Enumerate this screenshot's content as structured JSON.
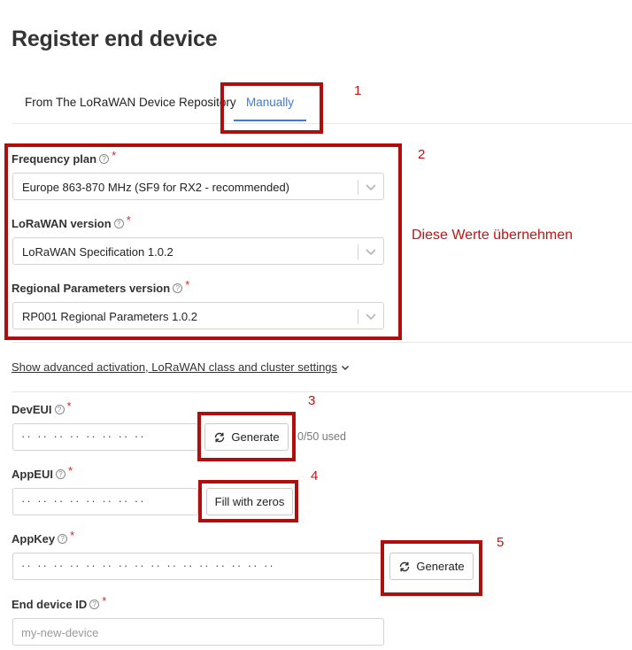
{
  "page": {
    "title": "Register end device"
  },
  "tabs": [
    {
      "label": "From The LoRaWAN Device Repository",
      "active": false
    },
    {
      "label": "Manually",
      "active": true
    }
  ],
  "fields": {
    "frequency_plan": {
      "label": "Frequency plan",
      "value": "Europe 863-870 MHz (SF9 for RX2 - recommended)"
    },
    "lorawan_version": {
      "label": "LoRaWAN version",
      "value": "LoRaWAN Specification 1.0.2"
    },
    "regional_params": {
      "label": "Regional Parameters version",
      "value": "RP001 Regional Parameters 1.0.2"
    },
    "dev_eui": {
      "label": "DevEUI",
      "value": "·· ·· ·· ·· ·· ·· ·· ··",
      "button": "Generate",
      "usage": "0/50 used"
    },
    "app_eui": {
      "label": "AppEUI",
      "value": "·· ·· ·· ·· ·· ·· ·· ··",
      "button": "Fill with zeros"
    },
    "app_key": {
      "label": "AppKey",
      "value": "·· ·· ·· ·· ·· ·· ·· ·· ·· ·· ·· ·· ·· ·· ·· ··",
      "button": "Generate"
    },
    "end_device_id": {
      "label": "End device ID",
      "placeholder": "my-new-device"
    }
  },
  "advanced_link": "Show advanced activation, LoRaWAN class and cluster settings",
  "help_symbol": "?",
  "required_symbol": "*",
  "annotations": {
    "numbers": [
      "1",
      "2",
      "3",
      "4",
      "5"
    ],
    "note": "Diese Werte übernehmen",
    "color": "#b00d0d"
  },
  "colors": {
    "accent": "#3b7be0",
    "required": "#dd2222"
  },
  "icons": {
    "help": "question-circle-icon",
    "select": "chevron-down-icon",
    "generate": "refresh-icon"
  }
}
